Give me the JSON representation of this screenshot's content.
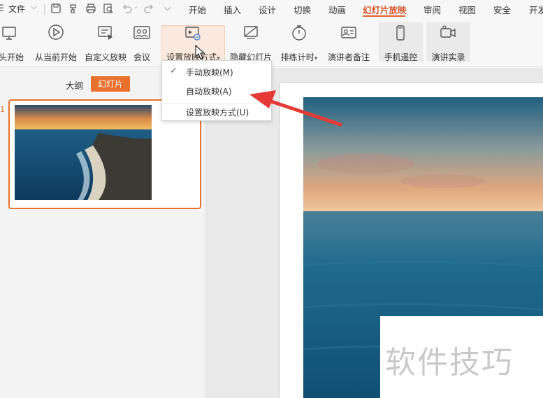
{
  "menubar": {
    "hamburger_icon": "menu-icon",
    "file_label": "文件",
    "tabs": [
      "开始",
      "插入",
      "设计",
      "切换",
      "动画",
      "幻灯片放映",
      "审阅",
      "视图",
      "安全",
      "开发"
    ],
    "active_tab": "幻灯片放映",
    "accent_color": "#e0632c"
  },
  "ribbon": {
    "buttons": [
      {
        "label": "头开始",
        "icon": "play-from-start-icon"
      },
      {
        "label": "从当前开始",
        "icon": "play-current-icon"
      },
      {
        "label": "自定义放映",
        "icon": "custom-show-icon"
      },
      {
        "label": "会议",
        "icon": "meeting-icon"
      },
      {
        "label": "设置放映方式",
        "icon": "setup-show-icon"
      },
      {
        "label": "隐藏幻灯片",
        "icon": "hide-slide-icon"
      },
      {
        "label": "排练计时",
        "icon": "stopwatch-icon"
      },
      {
        "label": "演讲者备注",
        "icon": "speaker-notes-icon"
      },
      {
        "label": "手机遥控",
        "icon": "phone-remote-icon"
      },
      {
        "label": "演讲实录",
        "icon": "record-icon"
      }
    ]
  },
  "dropdown": {
    "items": [
      {
        "label": "手动放映(M)",
        "checked": true
      },
      {
        "label": "自动放映(A)",
        "checked": false
      },
      {
        "label": "设置放映方式(U)",
        "checked": false
      }
    ]
  },
  "leftpanel": {
    "tab_outline": "大纲",
    "tab_slides": "幻灯片",
    "slide_number": "1"
  },
  "canvas": {
    "watermark": "软件技巧"
  },
  "colors": {
    "accent": "#e8712d",
    "arrow": "#e53935"
  }
}
